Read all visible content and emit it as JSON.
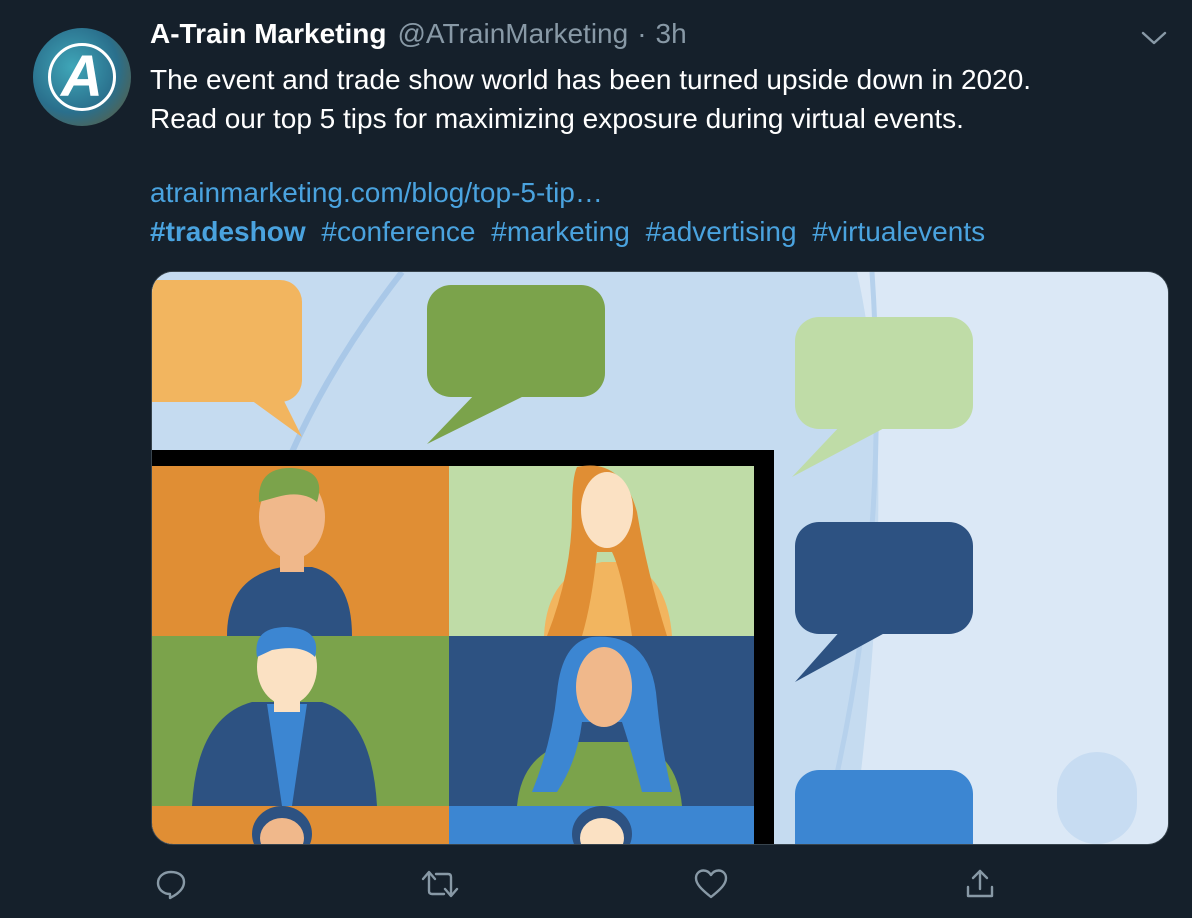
{
  "tweet": {
    "author_name": "A-Train Marketing",
    "author_handle": "@ATrainMarketing",
    "separator": "·",
    "time": "3h",
    "avatar_letter": "A",
    "body_line1": "The event and trade show world has been turned upside down in 2020.",
    "body_line2": "Read our top 5 tips for maximizing exposure during virtual events.",
    "link": "atrainmarketing.com/blog/top-5-tip…",
    "hashtags": [
      "#tradeshow",
      "#conference",
      "#marketing",
      "#advertising",
      "#virtualevents"
    ]
  },
  "icons": {
    "more": "chevron-down-icon",
    "reply": "reply-icon",
    "retweet": "retweet-icon",
    "like": "heart-icon",
    "share": "share-icon"
  },
  "colors": {
    "background": "#15202b",
    "link": "#4aa3df",
    "muted": "#8899a6"
  }
}
